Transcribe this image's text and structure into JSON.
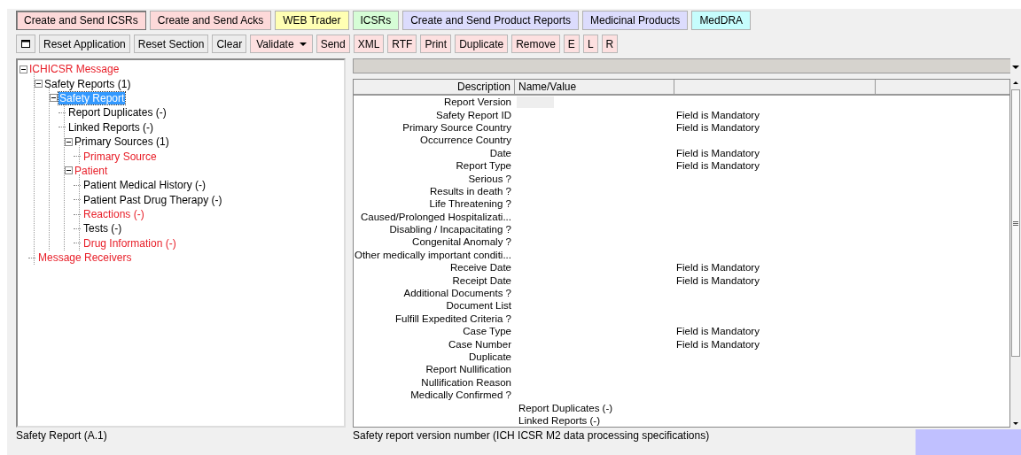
{
  "tabs": [
    {
      "label": "Create and Send ICSRs",
      "color": "#fdd9d9",
      "selected": true
    },
    {
      "label": "Create and Send Acks",
      "color": "#fdd9d9",
      "selected": false
    },
    {
      "label": "WEB Trader",
      "color": "#ffffb3",
      "selected": false
    },
    {
      "label": "ICSRs",
      "color": "#d6fdd6",
      "selected": false
    },
    {
      "label": "Create and Send Product Reports",
      "color": "#dcdcfd",
      "selected": false
    },
    {
      "label": "Medicinal Products",
      "color": "#dcdcfd",
      "selected": false
    },
    {
      "label": "MedDRA",
      "color": "#c6fdfd",
      "selected": false
    }
  ],
  "toolbar": [
    {
      "kind": "icon"
    },
    {
      "kind": "button",
      "label": "Reset Application",
      "color": "#ececec"
    },
    {
      "kind": "button",
      "label": "Reset Section",
      "color": "#ececec"
    },
    {
      "kind": "button",
      "label": "Clear",
      "color": "#ececec"
    },
    {
      "kind": "dropdown",
      "label": "Validate",
      "color": "#fde0e0"
    },
    {
      "kind": "button",
      "label": "Send",
      "color": "#fde0e0"
    },
    {
      "kind": "button",
      "label": "XML",
      "color": "#fde0e0"
    },
    {
      "kind": "button",
      "label": "RTF",
      "color": "#fde0e0"
    },
    {
      "kind": "button",
      "label": "Print",
      "color": "#fde0e0"
    },
    {
      "kind": "button",
      "label": "Duplicate",
      "color": "#fde0e0"
    },
    {
      "kind": "button",
      "label": "Remove",
      "color": "#fde0e0"
    },
    {
      "kind": "button",
      "label": "E",
      "color": "#fde0e0"
    },
    {
      "kind": "button",
      "label": "L",
      "color": "#fde0e0"
    },
    {
      "kind": "button",
      "label": "R",
      "color": "#fde0e0"
    }
  ],
  "tree": [
    {
      "label": "ICHICSR Message",
      "color": "#e8202a",
      "selected": false,
      "expanded": true,
      "children": [
        {
          "label": "Safety Reports (1)",
          "color": "#000000",
          "selected": false,
          "expanded": true,
          "children": [
            {
              "label": "Safety Report",
              "selected": true,
              "expanded": true,
              "children": [
                {
                  "label": "Report Duplicates (-)",
                  "color": "#000000",
                  "selected": false
                },
                {
                  "label": "Linked Reports (-)",
                  "color": "#000000",
                  "selected": false
                },
                {
                  "label": "Primary Sources (1)",
                  "color": "#000000",
                  "selected": false,
                  "expanded": true,
                  "children": [
                    {
                      "label": "Primary Source",
                      "color": "#e8202a",
                      "selected": false
                    }
                  ]
                },
                {
                  "label": "Patient",
                  "color": "#e8202a",
                  "selected": false,
                  "expanded": true,
                  "children": [
                    {
                      "label": "Patient Medical History (-)",
                      "color": "#000000",
                      "selected": false
                    },
                    {
                      "label": "Patient Past Drug Therapy (-)",
                      "color": "#000000",
                      "selected": false
                    },
                    {
                      "label": "Reactions (-)",
                      "color": "#e8202a",
                      "selected": false
                    },
                    {
                      "label": "Tests (-)",
                      "color": "#000000",
                      "selected": false
                    },
                    {
                      "label": "Drug Information (-)",
                      "color": "#e8202a",
                      "selected": false
                    }
                  ]
                }
              ]
            }
          ]
        },
        {
          "label": "Message Receivers",
          "color": "#e8202a",
          "selected": false
        }
      ]
    }
  ],
  "table": {
    "columns": [
      "Description",
      "Name/Value"
    ],
    "rows": [
      {
        "kind": "field",
        "description": "Report Version"
      },
      {
        "kind": "property",
        "description": "Safety Report ID",
        "note": "Field is Mandatory"
      },
      {
        "kind": "property",
        "description": "Primary Source Country",
        "note": "Field is Mandatory"
      },
      {
        "kind": "property",
        "description": "Occurrence Country"
      },
      {
        "kind": "property",
        "description": "Date",
        "note": "Field is Mandatory"
      },
      {
        "kind": "property",
        "description": "Report Type",
        "note": "Field is Mandatory"
      },
      {
        "kind": "property",
        "description": "Serious ?"
      },
      {
        "kind": "property",
        "description": "Results in death ?"
      },
      {
        "kind": "property",
        "description": "Life Threatening ?"
      },
      {
        "kind": "property",
        "description": "Caused/Prolonged Hospitalizati..."
      },
      {
        "kind": "property",
        "description": "Disabling / Incapacitating ?"
      },
      {
        "kind": "property",
        "description": "Congenital Anomaly ?"
      },
      {
        "kind": "property",
        "description": "Other medically important conditi..."
      },
      {
        "kind": "property",
        "description": "Receive Date",
        "note": "Field is Mandatory"
      },
      {
        "kind": "property",
        "description": "Receipt Date",
        "note": "Field is Mandatory"
      },
      {
        "kind": "property",
        "description": "Additional Documents ?"
      },
      {
        "kind": "property",
        "description": "Document List"
      },
      {
        "kind": "property",
        "description": "Fulfill Expedited Criteria ?"
      },
      {
        "kind": "property",
        "description": "Case Type",
        "note": "Field is Mandatory"
      },
      {
        "kind": "property",
        "description": "Case Number",
        "note": "Field is Mandatory"
      },
      {
        "kind": "property",
        "description": "Duplicate"
      },
      {
        "kind": "property",
        "description": "Report Nullification"
      },
      {
        "kind": "property",
        "description": "Nullification Reason"
      },
      {
        "kind": "property",
        "description": "Medically Confirmed ?"
      },
      {
        "kind": "child",
        "value": "Report Duplicates (-)"
      },
      {
        "kind": "child",
        "value": "Linked Reports (-)"
      }
    ]
  },
  "status_bar": {
    "left": "Safety Report (A.1)",
    "right": "Safety report version number (ICH ICSR M2 data processing specifications)"
  }
}
